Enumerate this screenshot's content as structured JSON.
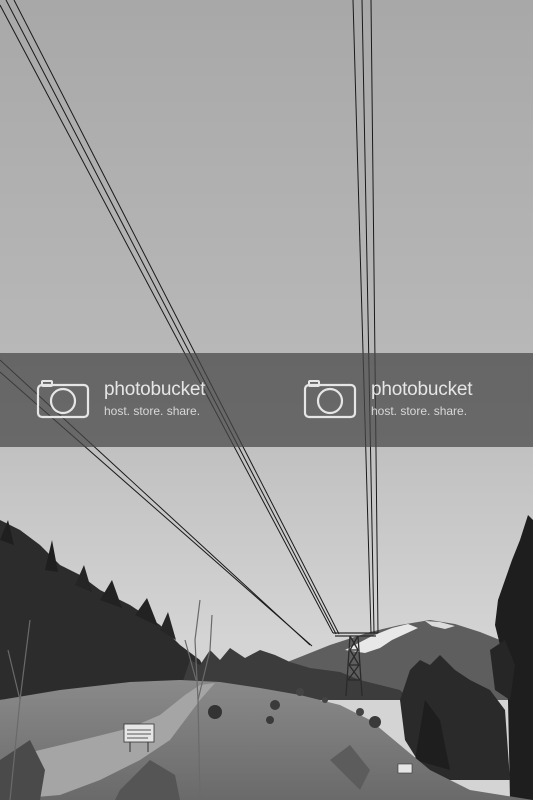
{
  "watermarks": [
    {
      "brand": "photobucket",
      "tagline": "host. store. share."
    },
    {
      "brand": "photobucket",
      "tagline": "host. store. share."
    }
  ],
  "sign": {
    "text": "ROAD RESTRICTED AREA CLOSED"
  }
}
